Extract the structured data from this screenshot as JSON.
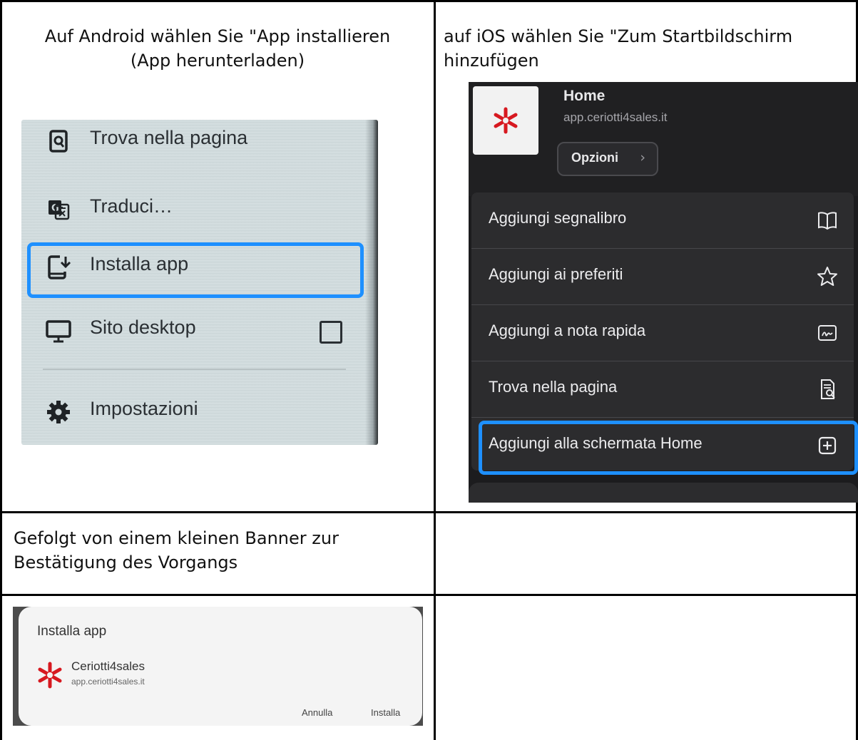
{
  "cells": {
    "android_text": "Auf Android wählen Sie \"App installieren (App herunterladen)",
    "ios_text": "auf iOS wählen Sie \"Zum Startbildschirm hinzufügen",
    "banner_text": "Gefolgt von einem kleinen Banner zur Bestätigung des Vorgangs"
  },
  "android_menu": {
    "items": [
      {
        "label": "Trova nella pagina",
        "icon": "find-in-page-icon"
      },
      {
        "label": "Traduci…",
        "icon": "translate-icon"
      },
      {
        "label": "Installa app",
        "icon": "install-app-icon"
      },
      {
        "label": "Sito desktop",
        "icon": "desktop-icon"
      },
      {
        "label": "Impostazioni",
        "icon": "gear-icon"
      }
    ],
    "highlight_color": "#1e90ff"
  },
  "ios_menu": {
    "title": "Home",
    "url": "app.ceriotti4sales.it",
    "options_label": "Opzioni",
    "items": [
      {
        "label": "Aggiungi segnalibro",
        "icon": "book-icon"
      },
      {
        "label": "Aggiungi ai preferiti",
        "icon": "star-icon"
      },
      {
        "label": "Aggiungi a nota rapida",
        "icon": "quick-note-icon"
      },
      {
        "label": "Trova nella pagina",
        "icon": "find-document-icon"
      },
      {
        "label": "Aggiungi alla schermata Home",
        "icon": "plus-square-icon"
      }
    ],
    "highlight_color": "#1e90ff"
  },
  "install_dialog": {
    "title": "Installa app",
    "app_name": "Ceriotti4sales",
    "app_url": "app.ceriotti4sales.it",
    "cancel_label": "Annulla",
    "install_label": "Installa",
    "logo_color": "#d71920"
  }
}
